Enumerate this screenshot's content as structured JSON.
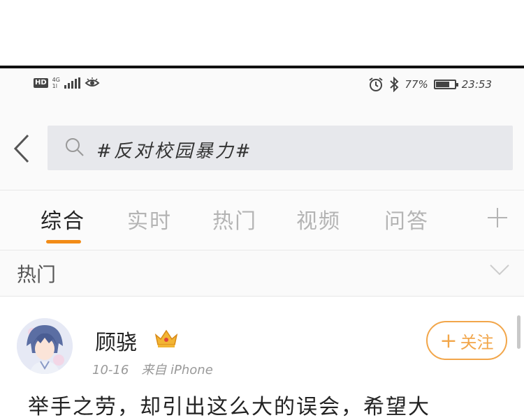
{
  "status_bar": {
    "hd": "HD",
    "network": "4G",
    "network_sub": "1l",
    "battery_percent": "77%",
    "battery_level": 0.77,
    "time": "23:53",
    "icons": [
      "eye-icon",
      "alarm-icon",
      "bluetooth-icon",
      "battery-icon"
    ]
  },
  "search": {
    "query": "#反对校园暴力#"
  },
  "tabs": [
    {
      "label": "综合",
      "active": true
    },
    {
      "label": "实时",
      "active": false
    },
    {
      "label": "热门",
      "active": false
    },
    {
      "label": "视频",
      "active": false
    },
    {
      "label": "问答",
      "active": false
    }
  ],
  "filter": {
    "label": "热门"
  },
  "post": {
    "username": "顾骁",
    "date": "10-16",
    "source": "来自 iPhone",
    "follow_label": "关注",
    "text": "举手之劳，却引出这么大的误会，希望大"
  },
  "colors": {
    "accent": "#f28c18",
    "follow": "#f2a64a",
    "search_bg": "#e7e8ec"
  }
}
